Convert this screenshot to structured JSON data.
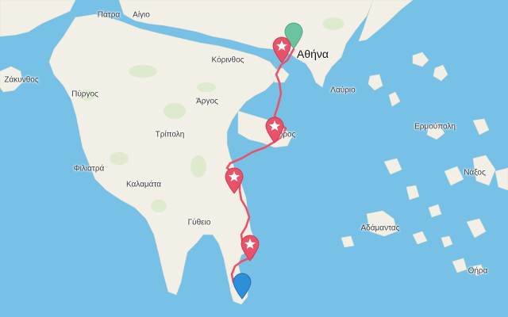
{
  "map": {
    "route_color": "#e8536a",
    "sea_color": "#78c1e6",
    "land_color": "#f2efe6",
    "labels": {
      "patra": "Πάτρα",
      "aigio": "Αίγιο",
      "athina": "Αθήνα",
      "korinthos": "Κόρινθος",
      "zakynthos": "Ζάκυνθος",
      "pyrgos": "Πύργος",
      "argos": "Άργος",
      "lavrio": "Λαύριο",
      "tripoli": "Τρίπολη",
      "poros": "Πόρος",
      "ermoupoli": "Ερμούπολη",
      "filiatra": "Φιλιατρά",
      "naxos": "Νάξος",
      "kalamata": "Καλαμάτα",
      "gytheio": "Γύθειο",
      "adamantas": "Αδάμαντας",
      "thira": "Θήρα"
    },
    "markers": [
      {
        "name": "start-marker-athens",
        "color": "#6cc3a0",
        "icon": "teardrop"
      },
      {
        "name": "stop-marker-1",
        "color": "#e8536a",
        "icon": "star"
      },
      {
        "name": "stop-marker-2",
        "color": "#e8536a",
        "icon": "star"
      },
      {
        "name": "stop-marker-3",
        "color": "#e8536a",
        "icon": "star"
      },
      {
        "name": "stop-marker-4",
        "color": "#e8536a",
        "icon": "star"
      },
      {
        "name": "end-marker",
        "color": "#2f8fd6",
        "icon": "teardrop"
      }
    ]
  }
}
